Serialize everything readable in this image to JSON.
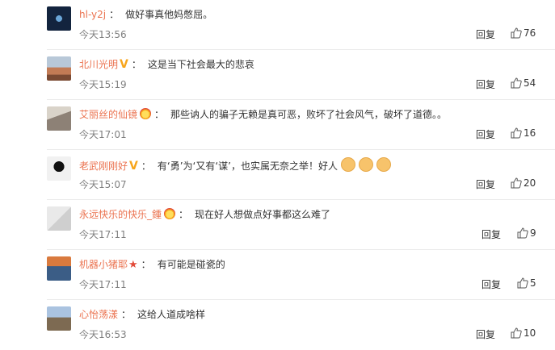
{
  "comments": [
    {
      "user": "hl-y2j",
      "badge": "",
      "text": "做好事真他妈憋屈。",
      "time": "今天13:56",
      "reply": "回复",
      "likes": "76",
      "emoji_count": 0
    },
    {
      "user": "北川光明",
      "badge": "v",
      "text": "这是当下社会最大的悲哀",
      "time": "今天15:19",
      "reply": "回复",
      "likes": "54",
      "emoji_count": 0
    },
    {
      "user": "艾丽丝的仙镜",
      "badge": "crown",
      "text": "那些讷人的骗子无赖是真可恶，败坏了社会风气，破坏了道德。。",
      "time": "今天17:01",
      "reply": "回复",
      "likes": "16",
      "emoji_count": 0
    },
    {
      "user": "老武刚刚好",
      "badge": "v",
      "text": "有‘勇’为‘又有‘谋’，也实属无奈之举！好人",
      "time": "今天15:07",
      "reply": "回复",
      "likes": "20",
      "emoji_count": 3
    },
    {
      "user": "永远快乐的快乐_鍾",
      "badge": "crown",
      "text": "现在好人想做点好事都这么难了",
      "time": "今天17:11",
      "reply": "回复",
      "likes": "9",
      "emoji_count": 0
    },
    {
      "user": "机器小猪耶",
      "badge": "star",
      "text": "有可能是碰瓷的",
      "time": "今天17:11",
      "reply": "回复",
      "likes": "5",
      "emoji_count": 0
    },
    {
      "user": "心怡荡漾",
      "badge": "",
      "text": "这给人道成啥样",
      "time": "今天16:53",
      "reply": "回复",
      "likes": "10",
      "emoji_count": 0
    }
  ]
}
